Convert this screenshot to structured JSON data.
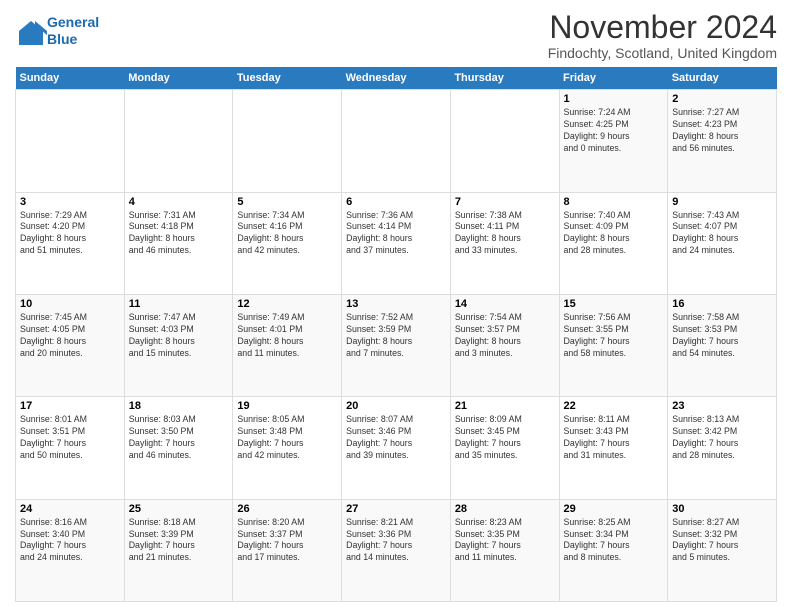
{
  "logo": {
    "line1": "General",
    "line2": "Blue"
  },
  "title": "November 2024",
  "subtitle": "Findochty, Scotland, United Kingdom",
  "colors": {
    "header_bg": "#2a7abf",
    "header_text": "#ffffff",
    "odd_row_bg": "#f9f9f9",
    "even_row_bg": "#ffffff"
  },
  "days_of_week": [
    "Sunday",
    "Monday",
    "Tuesday",
    "Wednesday",
    "Thursday",
    "Friday",
    "Saturday"
  ],
  "weeks": [
    [
      {
        "day": "",
        "info": ""
      },
      {
        "day": "",
        "info": ""
      },
      {
        "day": "",
        "info": ""
      },
      {
        "day": "",
        "info": ""
      },
      {
        "day": "",
        "info": ""
      },
      {
        "day": "1",
        "info": "Sunrise: 7:24 AM\nSunset: 4:25 PM\nDaylight: 9 hours\nand 0 minutes."
      },
      {
        "day": "2",
        "info": "Sunrise: 7:27 AM\nSunset: 4:23 PM\nDaylight: 8 hours\nand 56 minutes."
      }
    ],
    [
      {
        "day": "3",
        "info": "Sunrise: 7:29 AM\nSunset: 4:20 PM\nDaylight: 8 hours\nand 51 minutes."
      },
      {
        "day": "4",
        "info": "Sunrise: 7:31 AM\nSunset: 4:18 PM\nDaylight: 8 hours\nand 46 minutes."
      },
      {
        "day": "5",
        "info": "Sunrise: 7:34 AM\nSunset: 4:16 PM\nDaylight: 8 hours\nand 42 minutes."
      },
      {
        "day": "6",
        "info": "Sunrise: 7:36 AM\nSunset: 4:14 PM\nDaylight: 8 hours\nand 37 minutes."
      },
      {
        "day": "7",
        "info": "Sunrise: 7:38 AM\nSunset: 4:11 PM\nDaylight: 8 hours\nand 33 minutes."
      },
      {
        "day": "8",
        "info": "Sunrise: 7:40 AM\nSunset: 4:09 PM\nDaylight: 8 hours\nand 28 minutes."
      },
      {
        "day": "9",
        "info": "Sunrise: 7:43 AM\nSunset: 4:07 PM\nDaylight: 8 hours\nand 24 minutes."
      }
    ],
    [
      {
        "day": "10",
        "info": "Sunrise: 7:45 AM\nSunset: 4:05 PM\nDaylight: 8 hours\nand 20 minutes."
      },
      {
        "day": "11",
        "info": "Sunrise: 7:47 AM\nSunset: 4:03 PM\nDaylight: 8 hours\nand 15 minutes."
      },
      {
        "day": "12",
        "info": "Sunrise: 7:49 AM\nSunset: 4:01 PM\nDaylight: 8 hours\nand 11 minutes."
      },
      {
        "day": "13",
        "info": "Sunrise: 7:52 AM\nSunset: 3:59 PM\nDaylight: 8 hours\nand 7 minutes."
      },
      {
        "day": "14",
        "info": "Sunrise: 7:54 AM\nSunset: 3:57 PM\nDaylight: 8 hours\nand 3 minutes."
      },
      {
        "day": "15",
        "info": "Sunrise: 7:56 AM\nSunset: 3:55 PM\nDaylight: 7 hours\nand 58 minutes."
      },
      {
        "day": "16",
        "info": "Sunrise: 7:58 AM\nSunset: 3:53 PM\nDaylight: 7 hours\nand 54 minutes."
      }
    ],
    [
      {
        "day": "17",
        "info": "Sunrise: 8:01 AM\nSunset: 3:51 PM\nDaylight: 7 hours\nand 50 minutes."
      },
      {
        "day": "18",
        "info": "Sunrise: 8:03 AM\nSunset: 3:50 PM\nDaylight: 7 hours\nand 46 minutes."
      },
      {
        "day": "19",
        "info": "Sunrise: 8:05 AM\nSunset: 3:48 PM\nDaylight: 7 hours\nand 42 minutes."
      },
      {
        "day": "20",
        "info": "Sunrise: 8:07 AM\nSunset: 3:46 PM\nDaylight: 7 hours\nand 39 minutes."
      },
      {
        "day": "21",
        "info": "Sunrise: 8:09 AM\nSunset: 3:45 PM\nDaylight: 7 hours\nand 35 minutes."
      },
      {
        "day": "22",
        "info": "Sunrise: 8:11 AM\nSunset: 3:43 PM\nDaylight: 7 hours\nand 31 minutes."
      },
      {
        "day": "23",
        "info": "Sunrise: 8:13 AM\nSunset: 3:42 PM\nDaylight: 7 hours\nand 28 minutes."
      }
    ],
    [
      {
        "day": "24",
        "info": "Sunrise: 8:16 AM\nSunset: 3:40 PM\nDaylight: 7 hours\nand 24 minutes."
      },
      {
        "day": "25",
        "info": "Sunrise: 8:18 AM\nSunset: 3:39 PM\nDaylight: 7 hours\nand 21 minutes."
      },
      {
        "day": "26",
        "info": "Sunrise: 8:20 AM\nSunset: 3:37 PM\nDaylight: 7 hours\nand 17 minutes."
      },
      {
        "day": "27",
        "info": "Sunrise: 8:21 AM\nSunset: 3:36 PM\nDaylight: 7 hours\nand 14 minutes."
      },
      {
        "day": "28",
        "info": "Sunrise: 8:23 AM\nSunset: 3:35 PM\nDaylight: 7 hours\nand 11 minutes."
      },
      {
        "day": "29",
        "info": "Sunrise: 8:25 AM\nSunset: 3:34 PM\nDaylight: 7 hours\nand 8 minutes."
      },
      {
        "day": "30",
        "info": "Sunrise: 8:27 AM\nSunset: 3:32 PM\nDaylight: 7 hours\nand 5 minutes."
      }
    ]
  ]
}
